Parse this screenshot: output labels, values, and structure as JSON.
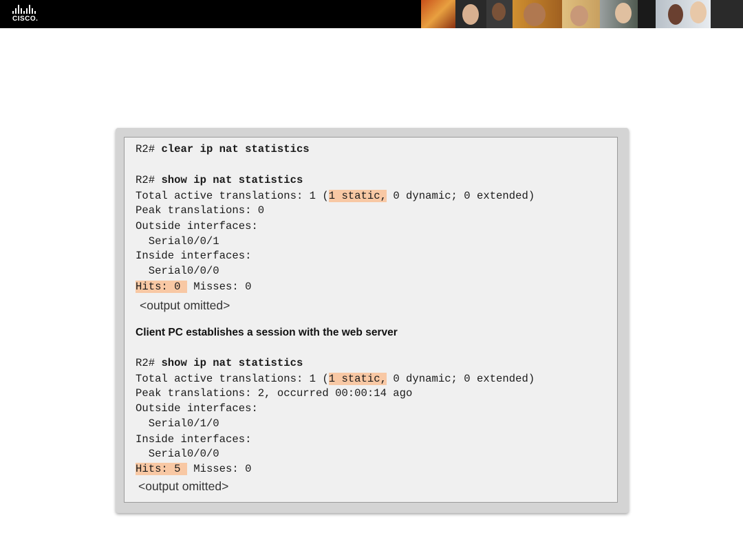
{
  "header": {
    "logo_text": "CISCO."
  },
  "block1": {
    "cmd1_prompt": "R2# ",
    "cmd1": "clear ip nat statistics",
    "cmd2_prompt": "R2# ",
    "cmd2": "show ip nat statistics",
    "total_pre": "Total active translations: 1 (",
    "total_hl": "1 static,",
    "total_post": " 0 dynamic; 0 extended)",
    "peak": "Peak translations: 0",
    "outside": "Outside interfaces:",
    "outside_if": "  Serial0/0/1",
    "inside": "Inside interfaces:",
    "inside_if": "  Serial0/0/0",
    "hits_hl": "Hits: 0 ",
    "hits_post": " Misses: 0",
    "omitted": "<output omitted>"
  },
  "caption": "Client PC establishes a session with the web server",
  "block2": {
    "cmd_prompt": "R2# ",
    "cmd": "show ip nat statistics",
    "total_pre": "Total active translations: 1 (",
    "total_hl": "1 static,",
    "total_post": " 0 dynamic; 0 extended)",
    "peak": "Peak translations: 2, occurred 00:00:14 ago",
    "outside": "Outside interfaces:",
    "outside_if": "  Serial0/1/0",
    "inside": "Inside interfaces:",
    "inside_if": "  Serial0/0/0",
    "hits_hl": "Hits: 5 ",
    "hits_post": " Misses: 0",
    "omitted": "<output omitted>"
  },
  "colors": {
    "highlight": "#f8c8a4",
    "panel_bg": "#f0f0f0",
    "header_bg": "#000000"
  }
}
